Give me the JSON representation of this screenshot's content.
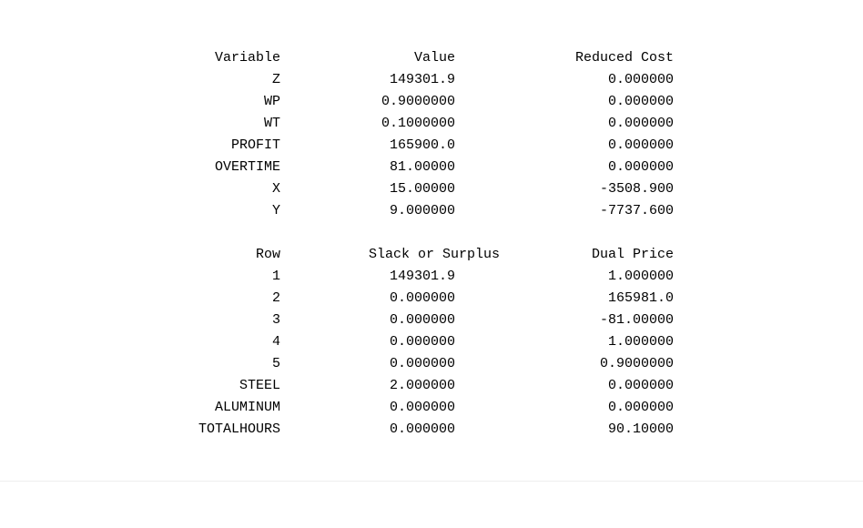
{
  "variables": {
    "headers": [
      "Variable",
      "Value",
      "Reduced Cost"
    ],
    "rows": [
      [
        "Z",
        "149301.9",
        "0.000000"
      ],
      [
        "WP",
        "0.9000000",
        "0.000000"
      ],
      [
        "WT",
        "0.1000000",
        "0.000000"
      ],
      [
        "PROFIT",
        "165900.0",
        "0.000000"
      ],
      [
        "OVERTIME",
        "81.00000",
        "0.000000"
      ],
      [
        "X",
        "15.00000",
        "-3508.900"
      ],
      [
        "Y",
        "9.000000",
        "-7737.600"
      ]
    ]
  },
  "constraints": {
    "headers": [
      "Row",
      "Slack or Surplus",
      "Dual Price"
    ],
    "rows": [
      [
        "1",
        "149301.9",
        "1.000000"
      ],
      [
        "2",
        "0.000000",
        "165981.0"
      ],
      [
        "3",
        "0.000000",
        "-81.00000"
      ],
      [
        "4",
        "0.000000",
        "1.000000"
      ],
      [
        "5",
        "0.000000",
        "0.9000000"
      ],
      [
        "STEEL",
        "2.000000",
        "0.000000"
      ],
      [
        "ALUMINUM",
        "0.000000",
        "0.000000"
      ],
      [
        "TOTALHOURS",
        "0.000000",
        "90.10000"
      ]
    ]
  }
}
